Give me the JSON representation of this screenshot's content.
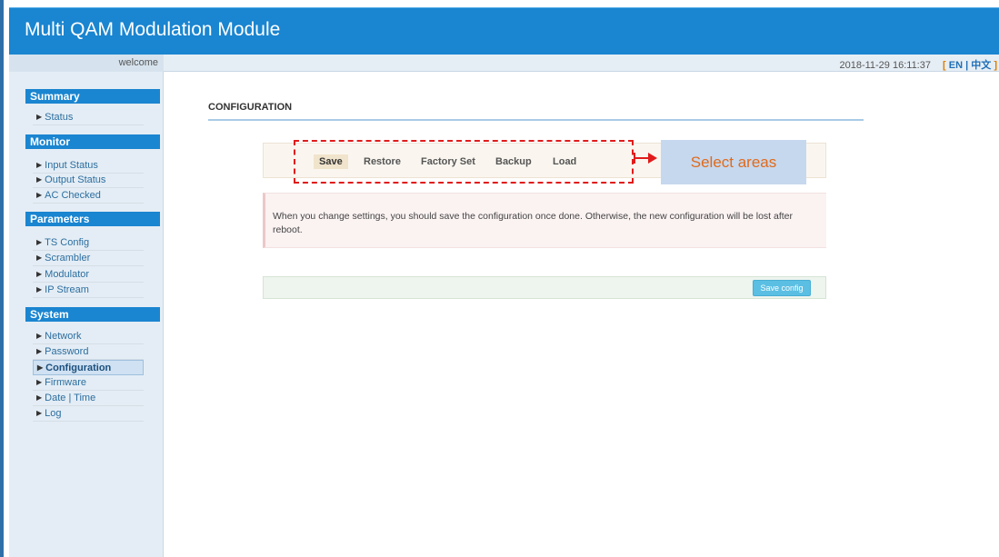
{
  "app": {
    "title": "Multi QAM Modulation Module"
  },
  "topbar": {
    "welcome": "welcome",
    "datetime": "2018-11-29 16:11:37",
    "lang_open": "[",
    "lang_en": "EN",
    "lang_sep": "|",
    "lang_zh": "中文",
    "lang_close": "]"
  },
  "sidebar": {
    "sections": [
      {
        "title": "Summary",
        "items": [
          "Status"
        ]
      },
      {
        "title": "Monitor",
        "items": [
          "Input Status",
          "Output Status",
          "AC Checked"
        ]
      },
      {
        "title": "Parameters",
        "items": [
          "TS Config",
          "Scrambler",
          "Modulator",
          "IP Stream"
        ]
      },
      {
        "title": "System",
        "items": [
          "Network",
          "Password",
          "Configuration",
          "Firmware",
          "Date | Time",
          "Log"
        ]
      }
    ],
    "active_item": "Configuration"
  },
  "main": {
    "page_title": "CONFIGURATION",
    "tabs": [
      "Save",
      "Restore",
      "Factory Set",
      "Backup",
      "Load"
    ],
    "active_tab": "Save",
    "notice": "When you change settings, you should save the configuration once done. Otherwise, the new configuration will be lost after reboot.",
    "save_button": "Save config"
  },
  "annotation": {
    "label": "Select areas"
  },
  "colors": {
    "header_blue": "#1a85d0",
    "section_blue": "#1a85d0",
    "annotation_red": "#e11b1b",
    "annotation_label_bg": "#c6d8ee",
    "annotation_label_text": "#e06a1b",
    "button_blue": "#5bbfe3"
  }
}
